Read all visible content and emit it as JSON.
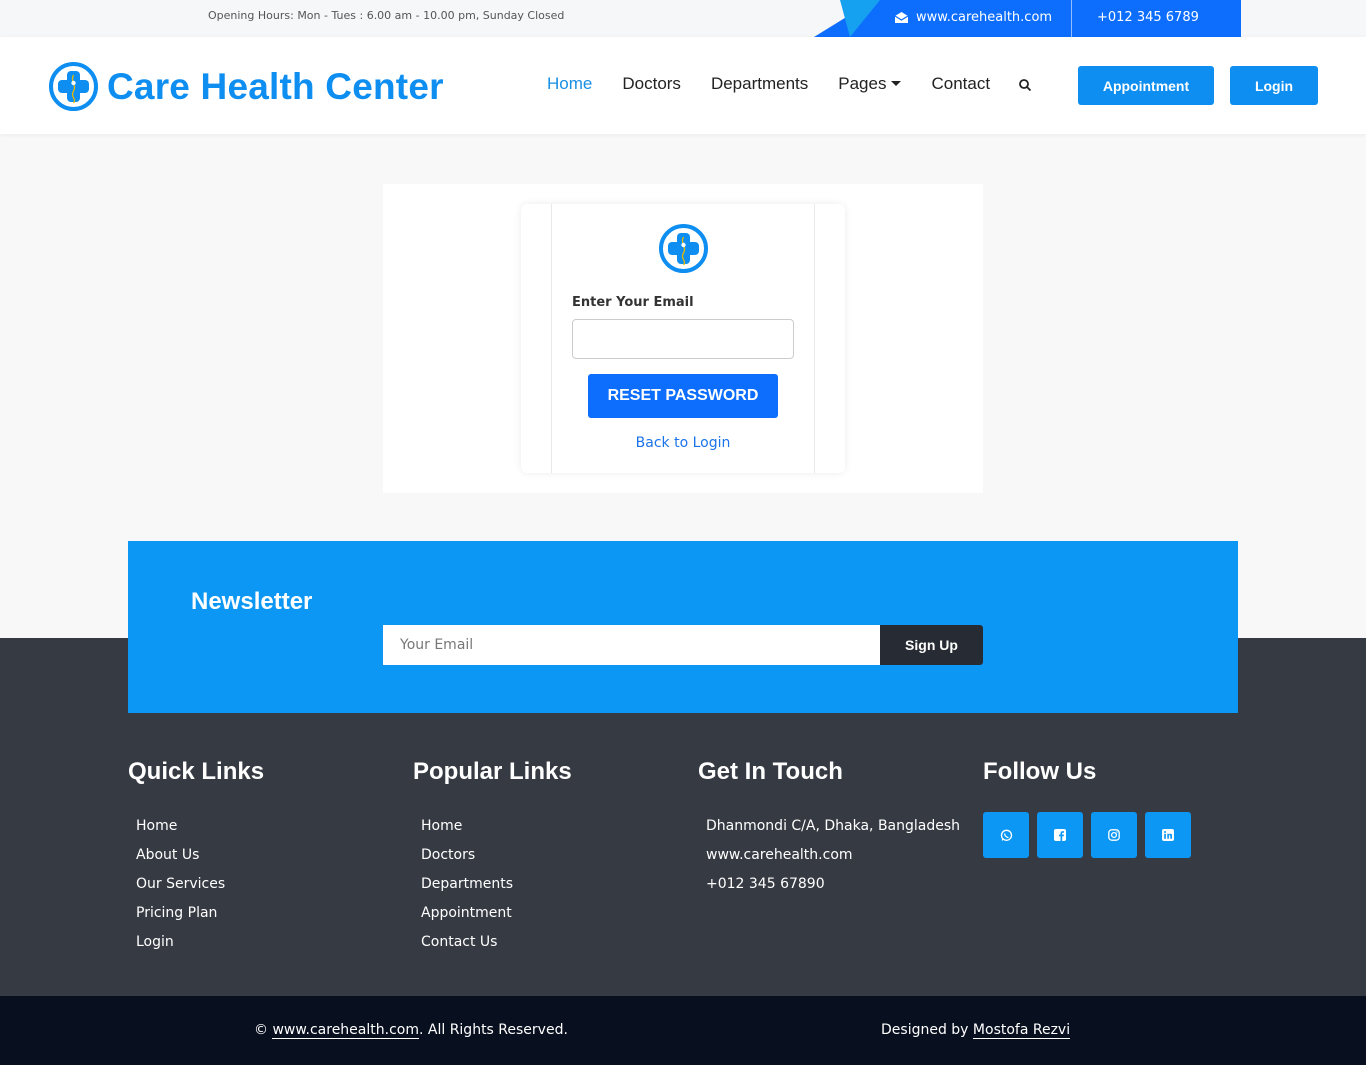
{
  "topbar": {
    "hours": "Opening Hours: Mon - Tues : 6.00 am - 10.00 pm, Sunday Closed",
    "website": "www.carehealth.com",
    "phone": "+012 345 6789",
    "mail_icon": "envelope-open-icon"
  },
  "header": {
    "brand": "Care Health Center",
    "logo_icon": "medical-cross-icon",
    "nav": [
      "Home",
      "Doctors",
      "Departments",
      "Pages",
      "Contact"
    ],
    "search_icon": "search-icon",
    "appointment": "Appointment",
    "login": "Login"
  },
  "reset": {
    "label": "Enter Your Email",
    "email_value": "",
    "button": "RESET PASSWORD",
    "back_link": "Back to Login"
  },
  "newsletter": {
    "title": "Newsletter",
    "placeholder": "Your Email",
    "button": "Sign Up"
  },
  "footer": {
    "quick_links": {
      "title": "Quick Links",
      "items": [
        "Home",
        "About Us",
        "Our Services",
        "Pricing Plan",
        "Login"
      ]
    },
    "popular_links": {
      "title": "Popular Links",
      "items": [
        "Home",
        "Doctors",
        "Departments",
        "Appointment",
        "Contact Us"
      ]
    },
    "get_in_touch": {
      "title": "Get In Touch",
      "address": "Dhanmondi C/A, Dhaka, Bangladesh",
      "website": "www.carehealth.com",
      "phone": "+012 345 67890"
    },
    "follow_us": {
      "title": "Follow Us",
      "icons": [
        "whatsapp-icon",
        "facebook-icon",
        "instagram-icon",
        "linkedin-icon"
      ]
    }
  },
  "bottom": {
    "copy_symbol": "©",
    "copy_link": "www.carehealth.com",
    "copy_rest": ". All Rights Reserved.",
    "designed_prefix": "Designed by",
    "designer": "Mostofa Rezvi"
  },
  "colors": {
    "primary": "#0d8ef0",
    "button": "#0d6efd",
    "newsletter_bg": "#0d97f5",
    "footer_bg": "#363a42",
    "bottom_bg": "#080f1f"
  }
}
